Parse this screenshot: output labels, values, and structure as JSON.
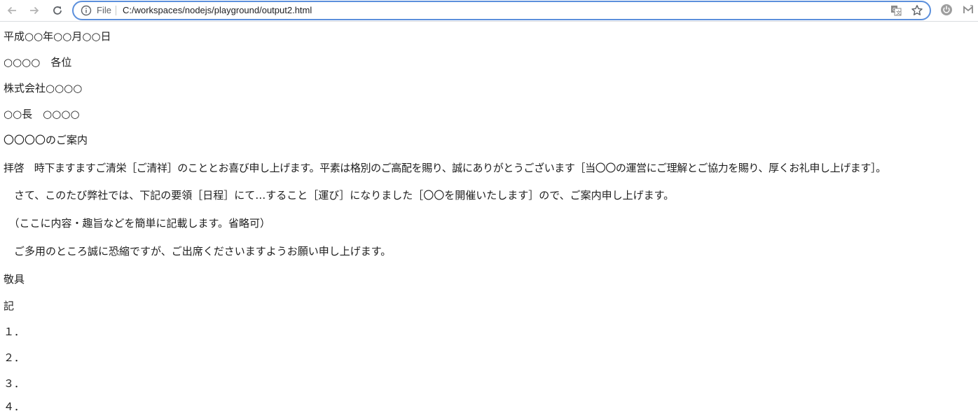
{
  "browser": {
    "scheme_label": "File",
    "url": "C:/workspaces/nodejs/playground/output2.html",
    "icons": {
      "back": "arrow-left-icon",
      "forward": "arrow-right-icon",
      "reload": "reload-icon",
      "info": "info-circle-icon",
      "translate": "translate-icon",
      "bookmark": "star-icon",
      "extension1": "power-icon",
      "extension2": "mail-icon"
    }
  },
  "document": {
    "date": "平成○○年○○月○○日",
    "recipient": "○○○○　各位",
    "sender_company": "株式会社○○○○",
    "sender_name": "○○長　○○○○",
    "title": "〇〇〇〇のご案内",
    "body": [
      "拝啓　時下ますますご清栄［ご清祥］のこととお喜び申し上げます。平素は格別のご高配を賜り、誠にありがとうございます［当〇〇の運営にご理解とご協力を賜り、厚くお礼申し上げます］。",
      "　さて、このたび弊社では、下記の要領［日程］にて…すること［運び］になりました［〇〇を開催いたします］ので、ご案内申し上げます。",
      "　（ここに内容・趣旨などを簡単に記載します。省略可）",
      "　ご多用のところ誠に恐縮ですが、ご出席くださいますようお願い申し上げます。"
    ],
    "closing": "敬具",
    "ki": "記",
    "items": [
      "１．",
      "２．",
      "３．",
      "４．"
    ]
  }
}
